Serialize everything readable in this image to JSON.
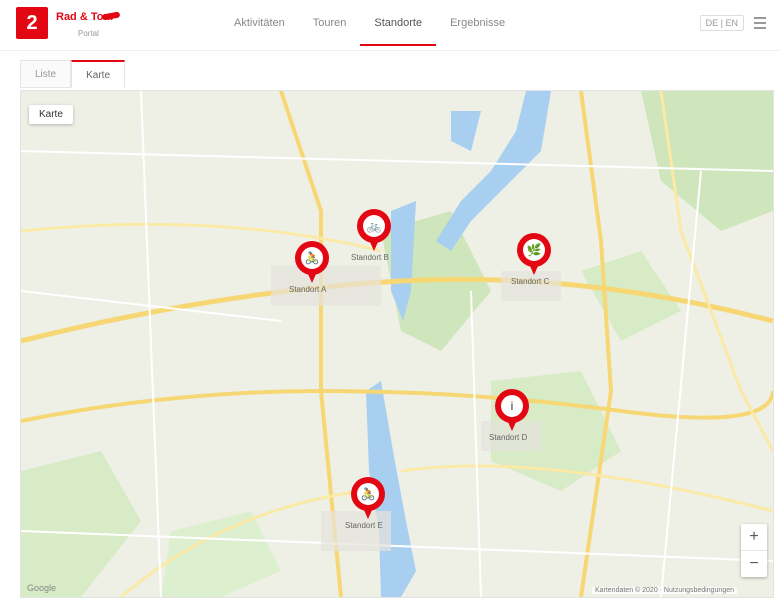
{
  "header": {
    "logo_box": "2",
    "logo_text": "Rad & Tour",
    "logo_sub": "Portal",
    "nav": [
      {
        "label": "Aktivitäten",
        "active": false
      },
      {
        "label": "Touren",
        "active": false
      },
      {
        "label": "Standorte",
        "active": true
      },
      {
        "label": "Ergebnisse",
        "active": false
      }
    ],
    "lang": "DE | EN",
    "menu_icon": "hamburger-icon"
  },
  "tabs": [
    {
      "label": "Liste",
      "active": false
    },
    {
      "label": "Karte",
      "active": true
    }
  ],
  "map": {
    "type_button": "Karte",
    "zoom_in": "+",
    "zoom_out": "−",
    "google": "Google",
    "attribution": "Kartendaten © 2020 · Nutzungsbedingungen",
    "markers": [
      {
        "icon": "cyclist-icon",
        "glyph": "🚴",
        "label": "Standort A"
      },
      {
        "icon": "bike-icon",
        "glyph": "🚲",
        "label": "Standort B"
      },
      {
        "icon": "leaf-icon",
        "glyph": "🌿",
        "label": "Standort C"
      },
      {
        "icon": "info-icon",
        "glyph": "i",
        "label": "Standort D"
      },
      {
        "icon": "cyclist-icon",
        "glyph": "🚴",
        "label": "Standort E"
      }
    ]
  },
  "colors": {
    "brand": "#e30613",
    "water": "#a9cff0",
    "park": "#c8e6b4",
    "road": "#f7d774"
  }
}
